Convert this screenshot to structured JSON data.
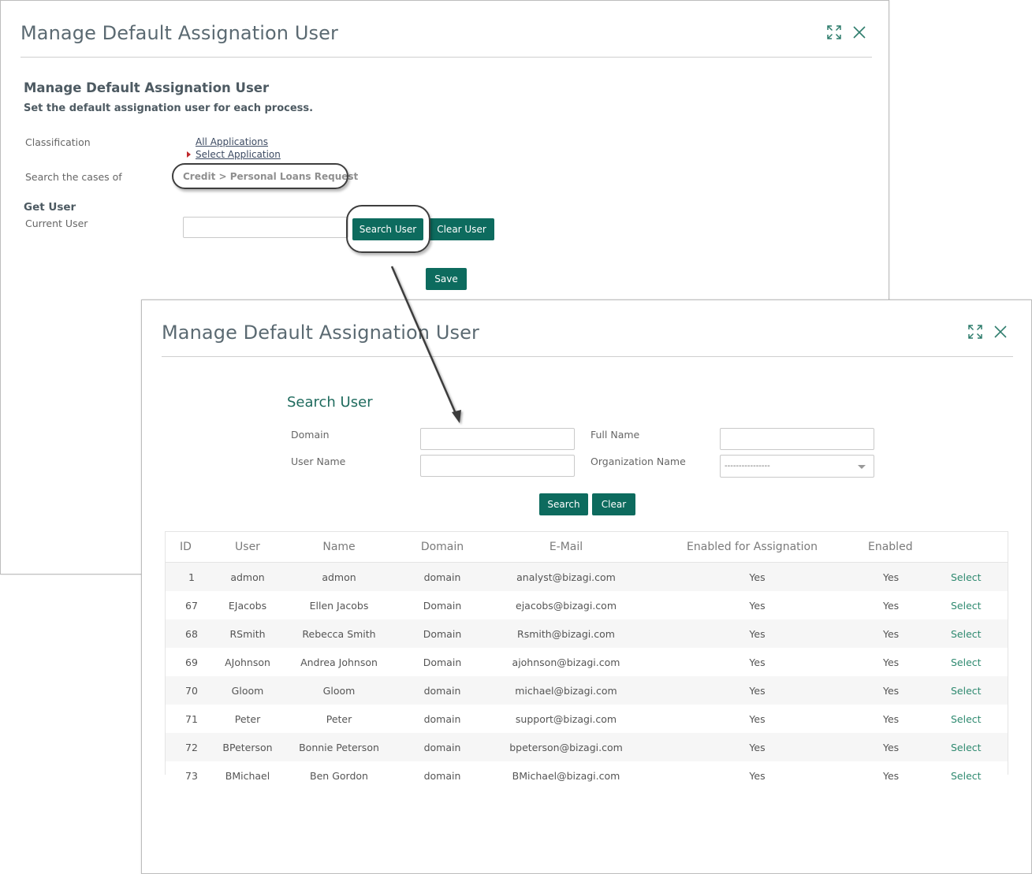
{
  "back_window": {
    "title": "Manage Default Assignation User",
    "heading": "Manage Default Assignation User",
    "subheading": "Set the default assignation user for each process.",
    "classification_label": "Classification",
    "all_applications_link": "All Applications",
    "select_application_link": "Select Application",
    "search_cases_label": "Search the cases of",
    "search_cases_value": "Credit > Personal Loans Request",
    "get_user_heading": "Get User",
    "current_user_label": "Current User",
    "current_user_value": "",
    "search_user_button": "Search User",
    "clear_user_button": "Clear User",
    "save_button": "Save",
    "icons": [
      "expand-icon",
      "close-icon"
    ]
  },
  "front_window": {
    "title": "Manage Default Assignation User",
    "search_heading": "Search User",
    "domain_label": "Domain",
    "domain_value": "",
    "full_name_label": "Full Name",
    "full_name_value": "",
    "user_name_label": "User Name",
    "user_name_value": "",
    "organization_label": "Organization Name",
    "organization_selected": "----------------",
    "search_button": "Search",
    "clear_button": "Clear",
    "icons": [
      "expand-icon",
      "close-icon"
    ]
  },
  "table": {
    "columns": [
      "ID",
      "User",
      "Name",
      "Domain",
      "E-Mail",
      "Enabled for Assignation",
      "Enabled",
      ""
    ],
    "rows": [
      {
        "id": "1",
        "user": "admon",
        "name": "admon",
        "domain": "domain",
        "email": "analyst@bizagi.com",
        "enabled_assignation": "Yes",
        "enabled": "Yes",
        "action": "Select"
      },
      {
        "id": "67",
        "user": "EJacobs",
        "name": "Ellen Jacobs",
        "domain": "Domain",
        "email": "ejacobs@bizagi.com",
        "enabled_assignation": "Yes",
        "enabled": "Yes",
        "action": "Select"
      },
      {
        "id": "68",
        "user": "RSmith",
        "name": "Rebecca Smith",
        "domain": "Domain",
        "email": "Rsmith@bizagi.com",
        "enabled_assignation": "Yes",
        "enabled": "Yes",
        "action": "Select"
      },
      {
        "id": "69",
        "user": "AJohnson",
        "name": "Andrea Johnson",
        "domain": "Domain",
        "email": "ajohnson@bizagi.com",
        "enabled_assignation": "Yes",
        "enabled": "Yes",
        "action": "Select"
      },
      {
        "id": "70",
        "user": "Gloom",
        "name": "Gloom",
        "domain": "domain",
        "email": "michael@bizagi.com",
        "enabled_assignation": "Yes",
        "enabled": "Yes",
        "action": "Select"
      },
      {
        "id": "71",
        "user": "Peter",
        "name": "Peter",
        "domain": "domain",
        "email": "support@bizagi.com",
        "enabled_assignation": "Yes",
        "enabled": "Yes",
        "action": "Select"
      },
      {
        "id": "72",
        "user": "BPeterson",
        "name": "Bonnie Peterson",
        "domain": "domain",
        "email": "bpeterson@bizagi.com",
        "enabled_assignation": "Yes",
        "enabled": "Yes",
        "action": "Select"
      },
      {
        "id": "73",
        "user": "BMichael",
        "name": "Ben Gordon",
        "domain": "domain",
        "email": "BMichael@bizagi.com",
        "enabled_assignation": "Yes",
        "enabled": "Yes",
        "action": "Select"
      }
    ]
  },
  "colors": {
    "accent": "#0d6b5e",
    "link_green": "#2f8a70",
    "title_gray": "#5b6a72"
  }
}
